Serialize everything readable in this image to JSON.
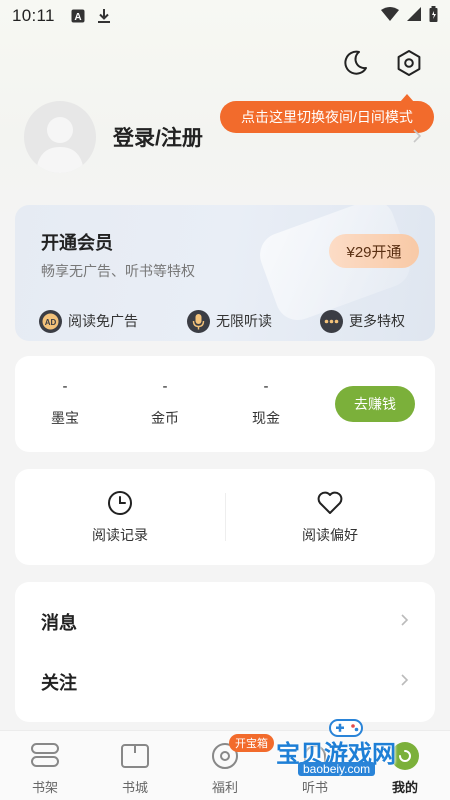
{
  "status_bar": {
    "time": "10:11"
  },
  "tooltip": "点击这里切换夜间/日间模式",
  "profile": {
    "login_label": "登录/注册"
  },
  "vip": {
    "title": "开通会员",
    "subtitle": "畅享无广告、听书等特权",
    "button": "¥29开通",
    "perks": [
      {
        "icon": "ad-free-icon",
        "label": "阅读免广告"
      },
      {
        "icon": "microphone-icon",
        "label": "无限听读"
      },
      {
        "icon": "more-dots-icon",
        "label": "更多特权"
      }
    ]
  },
  "wallet": {
    "items": [
      {
        "value": "-",
        "label": "墨宝"
      },
      {
        "value": "-",
        "label": "金币"
      },
      {
        "value": "-",
        "label": "现金"
      }
    ],
    "earn_button": "去赚钱"
  },
  "records": {
    "items": [
      {
        "icon": "clock-icon",
        "label": "阅读记录"
      },
      {
        "icon": "heart-icon",
        "label": "阅读偏好"
      }
    ]
  },
  "menu": {
    "items": [
      {
        "label": "消息"
      },
      {
        "label": "关注"
      }
    ]
  },
  "tabbar": {
    "badge": "开宝箱",
    "items": [
      {
        "icon": "bookshelf-icon",
        "label": "书架"
      },
      {
        "icon": "bookstore-icon",
        "label": "书城"
      },
      {
        "icon": "welfare-icon",
        "label": "福利"
      },
      {
        "icon": "listen-icon",
        "label": "听书"
      },
      {
        "icon": "profile-icon",
        "label": "我的"
      }
    ],
    "active_index": 4
  },
  "watermark": {
    "title": "宝贝游戏网",
    "url": "baobeiy.com"
  },
  "colors": {
    "accent_green": "#7bb03a",
    "tooltip_orange": "#f26b2c",
    "vip_button": "#f8c9a6"
  }
}
